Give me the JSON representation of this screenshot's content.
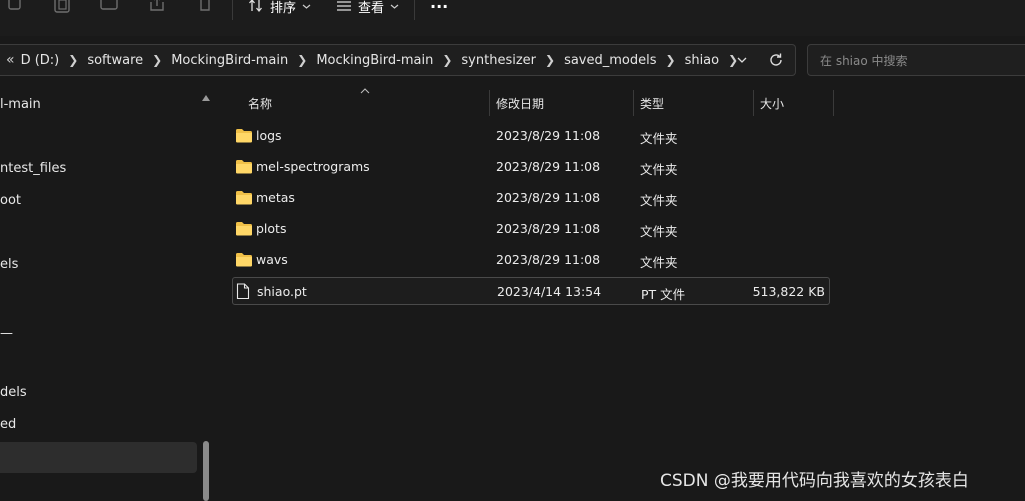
{
  "toolbar": {
    "sort_label": "排序",
    "view_label": "查看",
    "more_label": "···"
  },
  "address_bar": {
    "overflow": "«",
    "path": [
      "D (D:)",
      "software",
      "MockingBird-main",
      "MockingBird-main",
      "synthesizer",
      "saved_models",
      "shiao"
    ]
  },
  "search": {
    "placeholder": "在 shiao 中搜索"
  },
  "nav_pane": {
    "items": [
      "l-main",
      "ntest_files",
      "oot",
      "els",
      "—",
      "dels",
      "ed"
    ]
  },
  "columns": {
    "name": "名称",
    "date": "修改日期",
    "type": "类型",
    "size": "大小"
  },
  "files": [
    {
      "name": "logs",
      "date": "2023/8/29 11:08",
      "type": "文件夹",
      "size": "",
      "icon": "folder-icon"
    },
    {
      "name": "mel-spectrograms",
      "date": "2023/8/29 11:08",
      "type": "文件夹",
      "size": "",
      "icon": "folder-icon"
    },
    {
      "name": "metas",
      "date": "2023/8/29 11:08",
      "type": "文件夹",
      "size": "",
      "icon": "folder-icon"
    },
    {
      "name": "plots",
      "date": "2023/8/29 11:08",
      "type": "文件夹",
      "size": "",
      "icon": "folder-icon"
    },
    {
      "name": "wavs",
      "date": "2023/8/29 11:08",
      "type": "文件夹",
      "size": "",
      "icon": "folder-icon"
    },
    {
      "name": "shiao.pt",
      "date": "2023/4/14 13:54",
      "type": "PT 文件",
      "size": "513,822 KB",
      "icon": "file-icon"
    }
  ],
  "watermark": "CSDN @我要用代码向我喜欢的女孩表白",
  "colors": {
    "background": "#191919",
    "folder": "#f0c048",
    "text": "#ffffff"
  }
}
